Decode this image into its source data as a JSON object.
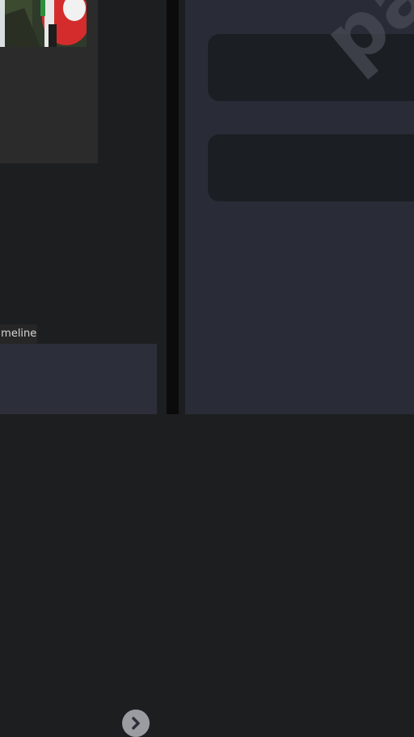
{
  "left_panel": {
    "timeline_label": "Timeline",
    "next_icon": "chevron-right-icon"
  },
  "right_panel": {
    "watermark_text": "par"
  },
  "colors": {
    "left_bg": "#1d1e1f",
    "right_bg": "#292c36",
    "field_bg": "#1b1e22",
    "button_bg": "#9a9ca2"
  }
}
